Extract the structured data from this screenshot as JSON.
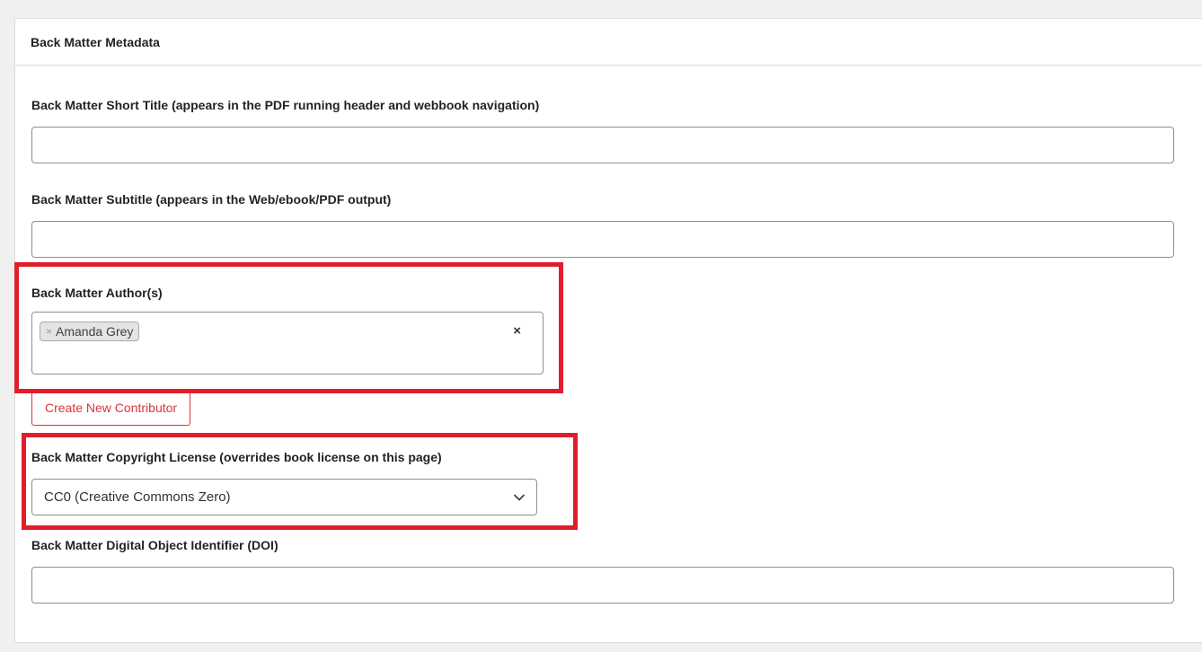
{
  "panel": {
    "title": "Back Matter Metadata"
  },
  "fields": {
    "short_title": {
      "label": "Back Matter Short Title (appears in the PDF running header and webbook navigation)",
      "value": ""
    },
    "subtitle": {
      "label": "Back Matter Subtitle (appears in the Web/ebook/PDF output)",
      "value": ""
    },
    "authors": {
      "label": "Back Matter Author(s)",
      "chips": [
        {
          "remove_glyph": "×",
          "name": "Amanda Grey"
        }
      ],
      "clear_glyph": "×"
    },
    "create_contributor": {
      "label": "Create New Contributor"
    },
    "license": {
      "label": "Back Matter Copyright License (overrides book license on this page)",
      "selected": "CC0 (Creative Commons Zero)",
      "icon": "chevron-down-icon"
    },
    "doi": {
      "label": "Back Matter Digital Object Identifier (DOI)",
      "value": ""
    }
  },
  "colors": {
    "highlight": "#e01e2b",
    "button_accent": "#d63638",
    "background": "#f0f0f1"
  }
}
